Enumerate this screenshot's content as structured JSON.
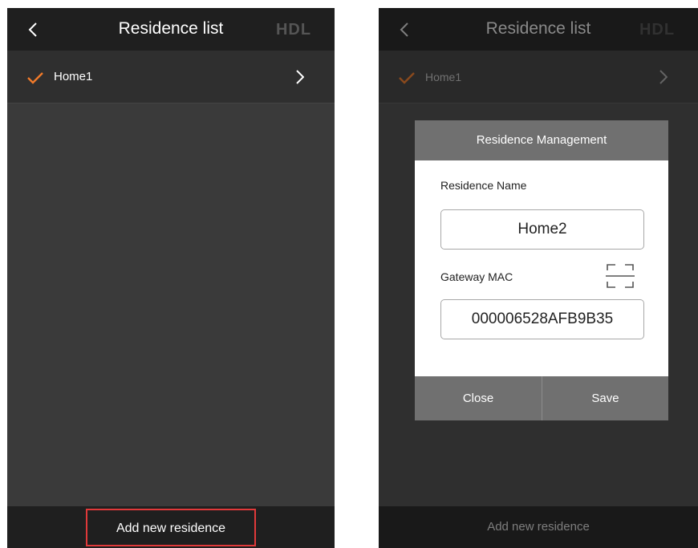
{
  "colors": {
    "header_bg": "#1f1f1f",
    "screen_bg": "#3a3a3a",
    "accent_check": "#f07a2a",
    "highlight_border": "#e0393a",
    "dialog_bar": "#707070"
  },
  "icons": [
    "chevron-left-icon",
    "hdl-logo",
    "checkmark-icon",
    "chevron-right-icon",
    "scan-icon"
  ],
  "left_screen": {
    "header": {
      "title": "Residence list",
      "logo_text": "HDL"
    },
    "residences": [
      {
        "name": "Home1",
        "selected": true
      }
    ],
    "bottom": {
      "add_label": "Add new residence"
    }
  },
  "right_screen": {
    "header": {
      "title": "Residence list",
      "logo_text": "HDL"
    },
    "residences": [
      {
        "name": "Home1",
        "selected": true
      }
    ],
    "bottom": {
      "add_label": "Add new residence"
    },
    "dialog": {
      "title": "Residence Management",
      "name_label": "Residence Name",
      "name_value": "Home2",
      "mac_label": "Gateway MAC",
      "mac_value": "000006528AFB9B35",
      "close_label": "Close",
      "save_label": "Save"
    }
  }
}
